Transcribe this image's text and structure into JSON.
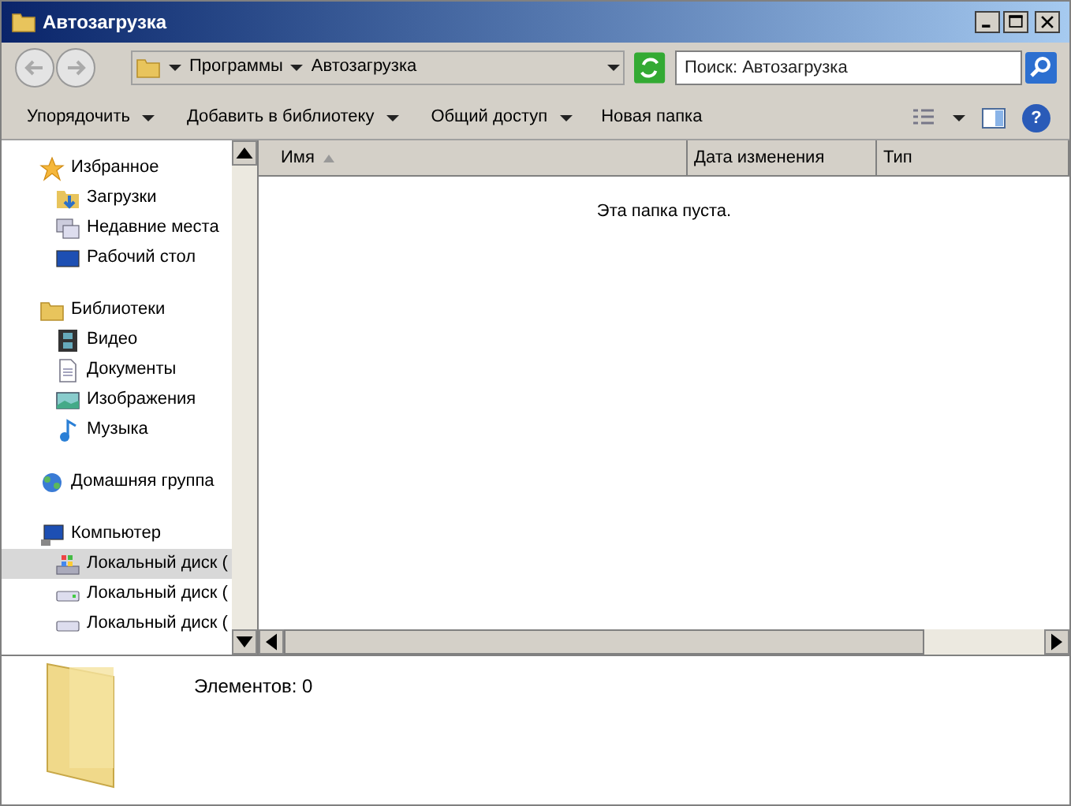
{
  "window": {
    "title": "Автозагрузка"
  },
  "address": {
    "crumbs": [
      "Программы",
      "Автозагрузка"
    ]
  },
  "search": {
    "placeholder": "Поиск: Автозагрузка"
  },
  "toolbar": {
    "menus": [
      "Упорядочить",
      "Добавить в библиотеку",
      "Общий доступ"
    ],
    "button": "Новая папка",
    "help": "?"
  },
  "sidebar": {
    "groups": [
      {
        "label": "Избранное",
        "selected": false,
        "children": [
          {
            "label": "Загрузки",
            "selected": false
          },
          {
            "label": "Недавние места",
            "selected": false
          },
          {
            "label": "Рабочий стол",
            "selected": false
          }
        ]
      },
      {
        "label": "Библиотеки",
        "selected": false,
        "children": [
          {
            "label": "Видео",
            "selected": false
          },
          {
            "label": "Документы",
            "selected": false
          },
          {
            "label": "Изображения",
            "selected": false
          },
          {
            "label": "Музыка",
            "selected": false
          }
        ]
      },
      {
        "label": "Домашняя группа",
        "selected": false
      },
      {
        "label": "Компьютер",
        "selected": false,
        "children": [
          {
            "label": "Локальный диск (",
            "selected": true
          },
          {
            "label": "Локальный диск (",
            "selected": false
          },
          {
            "label": "Локальный диск (",
            "selected": false
          }
        ]
      }
    ]
  },
  "table": {
    "columns": [
      {
        "label": "Имя",
        "sorted": true
      },
      {
        "label": "Дата изменения",
        "sorted": false
      },
      {
        "label": "Тип",
        "sorted": false
      }
    ],
    "empty_text": "Эта папка пуста."
  },
  "details": {
    "text": "Элементов: 0"
  }
}
